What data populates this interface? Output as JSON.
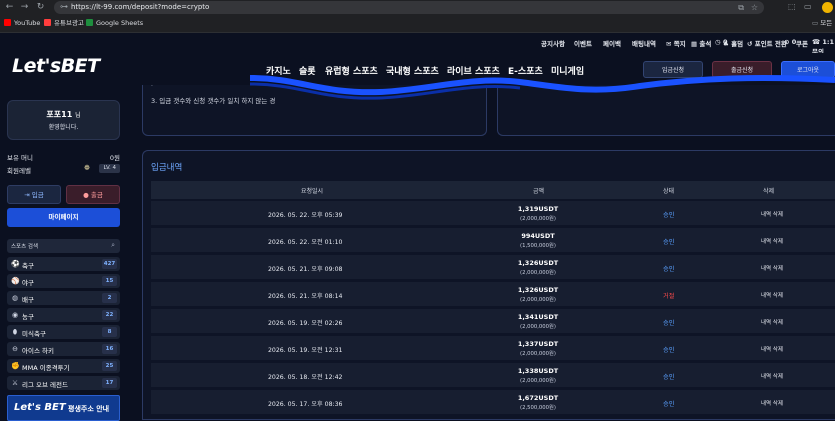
{
  "browser": {
    "url": "https://lt-99.com/deposit?mode=crypto",
    "bookmarks": [
      {
        "label": "YouTube",
        "color": "#ff0000"
      },
      {
        "label": "유튜브광고",
        "color": "#ff3d3d"
      },
      {
        "label": "Google Sheets",
        "color": "#1e8e3e"
      }
    ],
    "folder_label": "모든"
  },
  "topbar": {
    "links": [
      "공지사항",
      "이벤트",
      "페이백",
      "배팅내역"
    ],
    "right_links": [
      "쪽지",
      "출석",
      "0",
      "홀덤",
      "포인트 전환",
      "0",
      "쿠폰",
      "1:1 문의"
    ]
  },
  "header": {
    "logo_main": "Let's",
    "logo_bet": "BET",
    "nav": [
      "카지노",
      "슬롯",
      "유럽형 스포츠",
      "국내형 스포츠",
      "라이브 스포츠",
      "E-스포츠",
      "미니게임"
    ],
    "buttons": [
      "입금신청",
      "출금신청",
      "로그아웃"
    ]
  },
  "sidebar": {
    "username": "포포11",
    "suffix": "님",
    "greeting": "환영합니다.",
    "money_label": "보유 머니",
    "money_value": "0원",
    "level_label": "회원레벨",
    "level_value": "LV. 4",
    "deposit_btn": "입금",
    "withdraw_btn": "출금",
    "mypage_btn": "마이페이지",
    "sports_search": "스포츠 검색",
    "sports": [
      {
        "name": "축구",
        "count": "427",
        "icon": "soccer-icon"
      },
      {
        "name": "야구",
        "count": "15",
        "icon": "baseball-icon"
      },
      {
        "name": "배구",
        "count": "2",
        "icon": "volleyball-icon"
      },
      {
        "name": "농구",
        "count": "22",
        "icon": "basketball-icon"
      },
      {
        "name": "미식축구",
        "count": "8",
        "icon": "football-icon"
      },
      {
        "name": "아이스 하키",
        "count": "16",
        "icon": "hockey-icon"
      },
      {
        "name": "MMA 이종격투기",
        "count": "25",
        "icon": "mma-icon"
      },
      {
        "name": "리그 오브 레전드",
        "count": "17",
        "icon": "lol-icon"
      }
    ],
    "banner_logo": "Let's BET",
    "banner_text": "평생주소 안내"
  },
  "main": {
    "note": "3. 입금 갯수와 신청 갯수가 일치 하지 않는 경",
    "section_title": "입금내역",
    "columns": [
      "요청일시",
      "금액",
      "상태",
      "삭제"
    ],
    "rows": [
      {
        "date": "2026. 05. 22. 오후 05:39",
        "usdt": "1,319USDT",
        "krw": "(2,000,000원)",
        "status": "승인",
        "status_color": "#5aa0ff",
        "action": "내역 삭제"
      },
      {
        "date": "2026. 05. 22. 오전 01:10",
        "usdt": "994USDT",
        "krw": "(1,500,000원)",
        "status": "승인",
        "status_color": "#5aa0ff",
        "action": "내역 삭제"
      },
      {
        "date": "2026. 05. 21. 오후 09:08",
        "usdt": "1,326USDT",
        "krw": "(2,000,000원)",
        "status": "승인",
        "status_color": "#5aa0ff",
        "action": "내역 삭제"
      },
      {
        "date": "2026. 05. 21. 오후 08:14",
        "usdt": "1,326USDT",
        "krw": "(2,000,000원)",
        "status": "거절",
        "status_color": "#ff4b4b",
        "action": "내역 삭제"
      },
      {
        "date": "2026. 05. 19. 오전 02:26",
        "usdt": "1,341USDT",
        "krw": "(2,000,000원)",
        "status": "승인",
        "status_color": "#5aa0ff",
        "action": "내역 삭제"
      },
      {
        "date": "2026. 05. 19. 오전 12:31",
        "usdt": "1,337USDT",
        "krw": "(2,000,000원)",
        "status": "승인",
        "status_color": "#5aa0ff",
        "action": "내역 삭제"
      },
      {
        "date": "2026. 05. 18. 오전 12:42",
        "usdt": "1,338USDT",
        "krw": "(2,000,000원)",
        "status": "승인",
        "status_color": "#5aa0ff",
        "action": "내역 삭제"
      },
      {
        "date": "2026. 05. 17. 오후 08:36",
        "usdt": "1,672USDT",
        "krw": "(2,500,000원)",
        "status": "승인",
        "status_color": "#5aa0ff",
        "action": "내역 삭제"
      }
    ]
  }
}
